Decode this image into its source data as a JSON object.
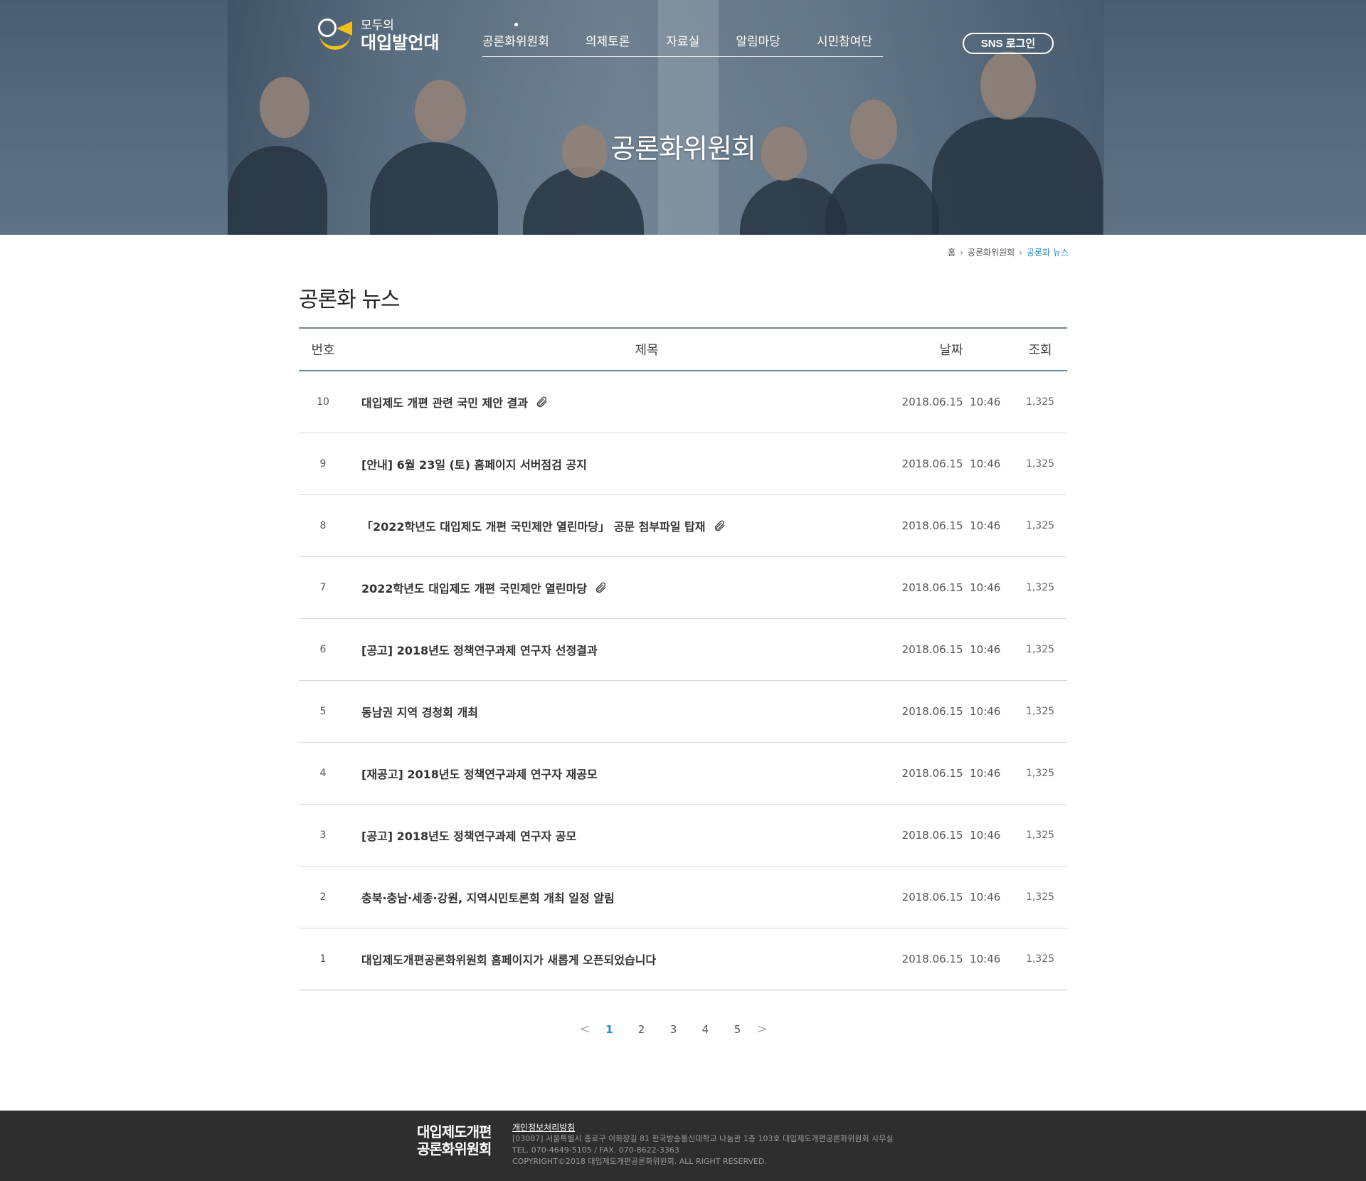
{
  "header": {
    "logo_line1": "모두의",
    "logo_line2": "대입발언대",
    "nav": [
      "공론화위원회",
      "의제토론",
      "자료실",
      "알림마당",
      "시민참여단"
    ],
    "sns_login": "SNS 로그인",
    "hero_title": "공론화위원회"
  },
  "breadcrumb": {
    "home": "홈",
    "level1": "공론화위원회",
    "current": "공론화 뉴스"
  },
  "page_title": "공론화 뉴스",
  "board": {
    "headers": {
      "num": "번호",
      "title": "제목",
      "date": "날짜",
      "views": "조회"
    },
    "rows": [
      {
        "num": "10",
        "title": "대입제도 개편 관련 국민 제안 결과",
        "attach": true,
        "date": "2018.06.15  10:46",
        "views": "1,325"
      },
      {
        "num": "9",
        "title": "[안내] 6월 23일 (토) 홈페이지 서버점검 공지",
        "attach": false,
        "date": "2018.06.15  10:46",
        "views": "1,325"
      },
      {
        "num": "8",
        "title": "「2022학년도 대입제도 개편 국민제안 열린마당」 공문 첨부파일 탑재",
        "attach": true,
        "date": "2018.06.15  10:46",
        "views": "1,325"
      },
      {
        "num": "7",
        "title": "2022학년도 대입제도 개편 국민제안 열린마당",
        "attach": true,
        "date": "2018.06.15  10:46",
        "views": "1,325"
      },
      {
        "num": "6",
        "title": "[공고] 2018년도 정책연구과제 연구자 선정결과",
        "attach": false,
        "date": "2018.06.15  10:46",
        "views": "1,325"
      },
      {
        "num": "5",
        "title": "동남권 지역 경청회 개최",
        "attach": false,
        "date": "2018.06.15  10:46",
        "views": "1,325"
      },
      {
        "num": "4",
        "title": "[재공고] 2018년도 정책연구과제 연구자 재공모",
        "attach": false,
        "date": "2018.06.15  10:46",
        "views": "1,325"
      },
      {
        "num": "3",
        "title": "[공고] 2018년도 정책연구과제 연구자 공모",
        "attach": false,
        "date": "2018.06.15  10:46",
        "views": "1,325"
      },
      {
        "num": "2",
        "title": "충북·충남·세종·강원, 지역시민토론회 개최 일정 알림",
        "attach": false,
        "date": "2018.06.15  10:46",
        "views": "1,325"
      },
      {
        "num": "1",
        "title": "대입제도개편공론화위원회 홈페이지가 새롭게 오픈되었습니다",
        "attach": false,
        "date": "2018.06.15  10:46",
        "views": "1,325"
      }
    ]
  },
  "pagination": {
    "prev": "<",
    "pages": [
      "1",
      "2",
      "3",
      "4",
      "5"
    ],
    "current": "1",
    "next": ">"
  },
  "footer": {
    "logo_line1": "대입제도개편",
    "logo_line2": "공론화위원회",
    "privacy": "개인정보처리방침",
    "address": "[03087] 서울특별시 종로구 이화장길 81 한국방송통신대학교 나눔관 1층 103호 대입제도개편공론화위원회 사무실",
    "contact": "TEL. 070-4649-5105 / FAX. 070-8622-3363",
    "copyright": "COPYRIGHT©2018 대입제도개편공론화위원회. ALL RIGHT RESERVED."
  },
  "colors": {
    "accent": "#1a8fd0",
    "table_border": "#6d8598",
    "footer_bg": "#2e2e2e",
    "logo_yellow": "#f2c21b"
  }
}
